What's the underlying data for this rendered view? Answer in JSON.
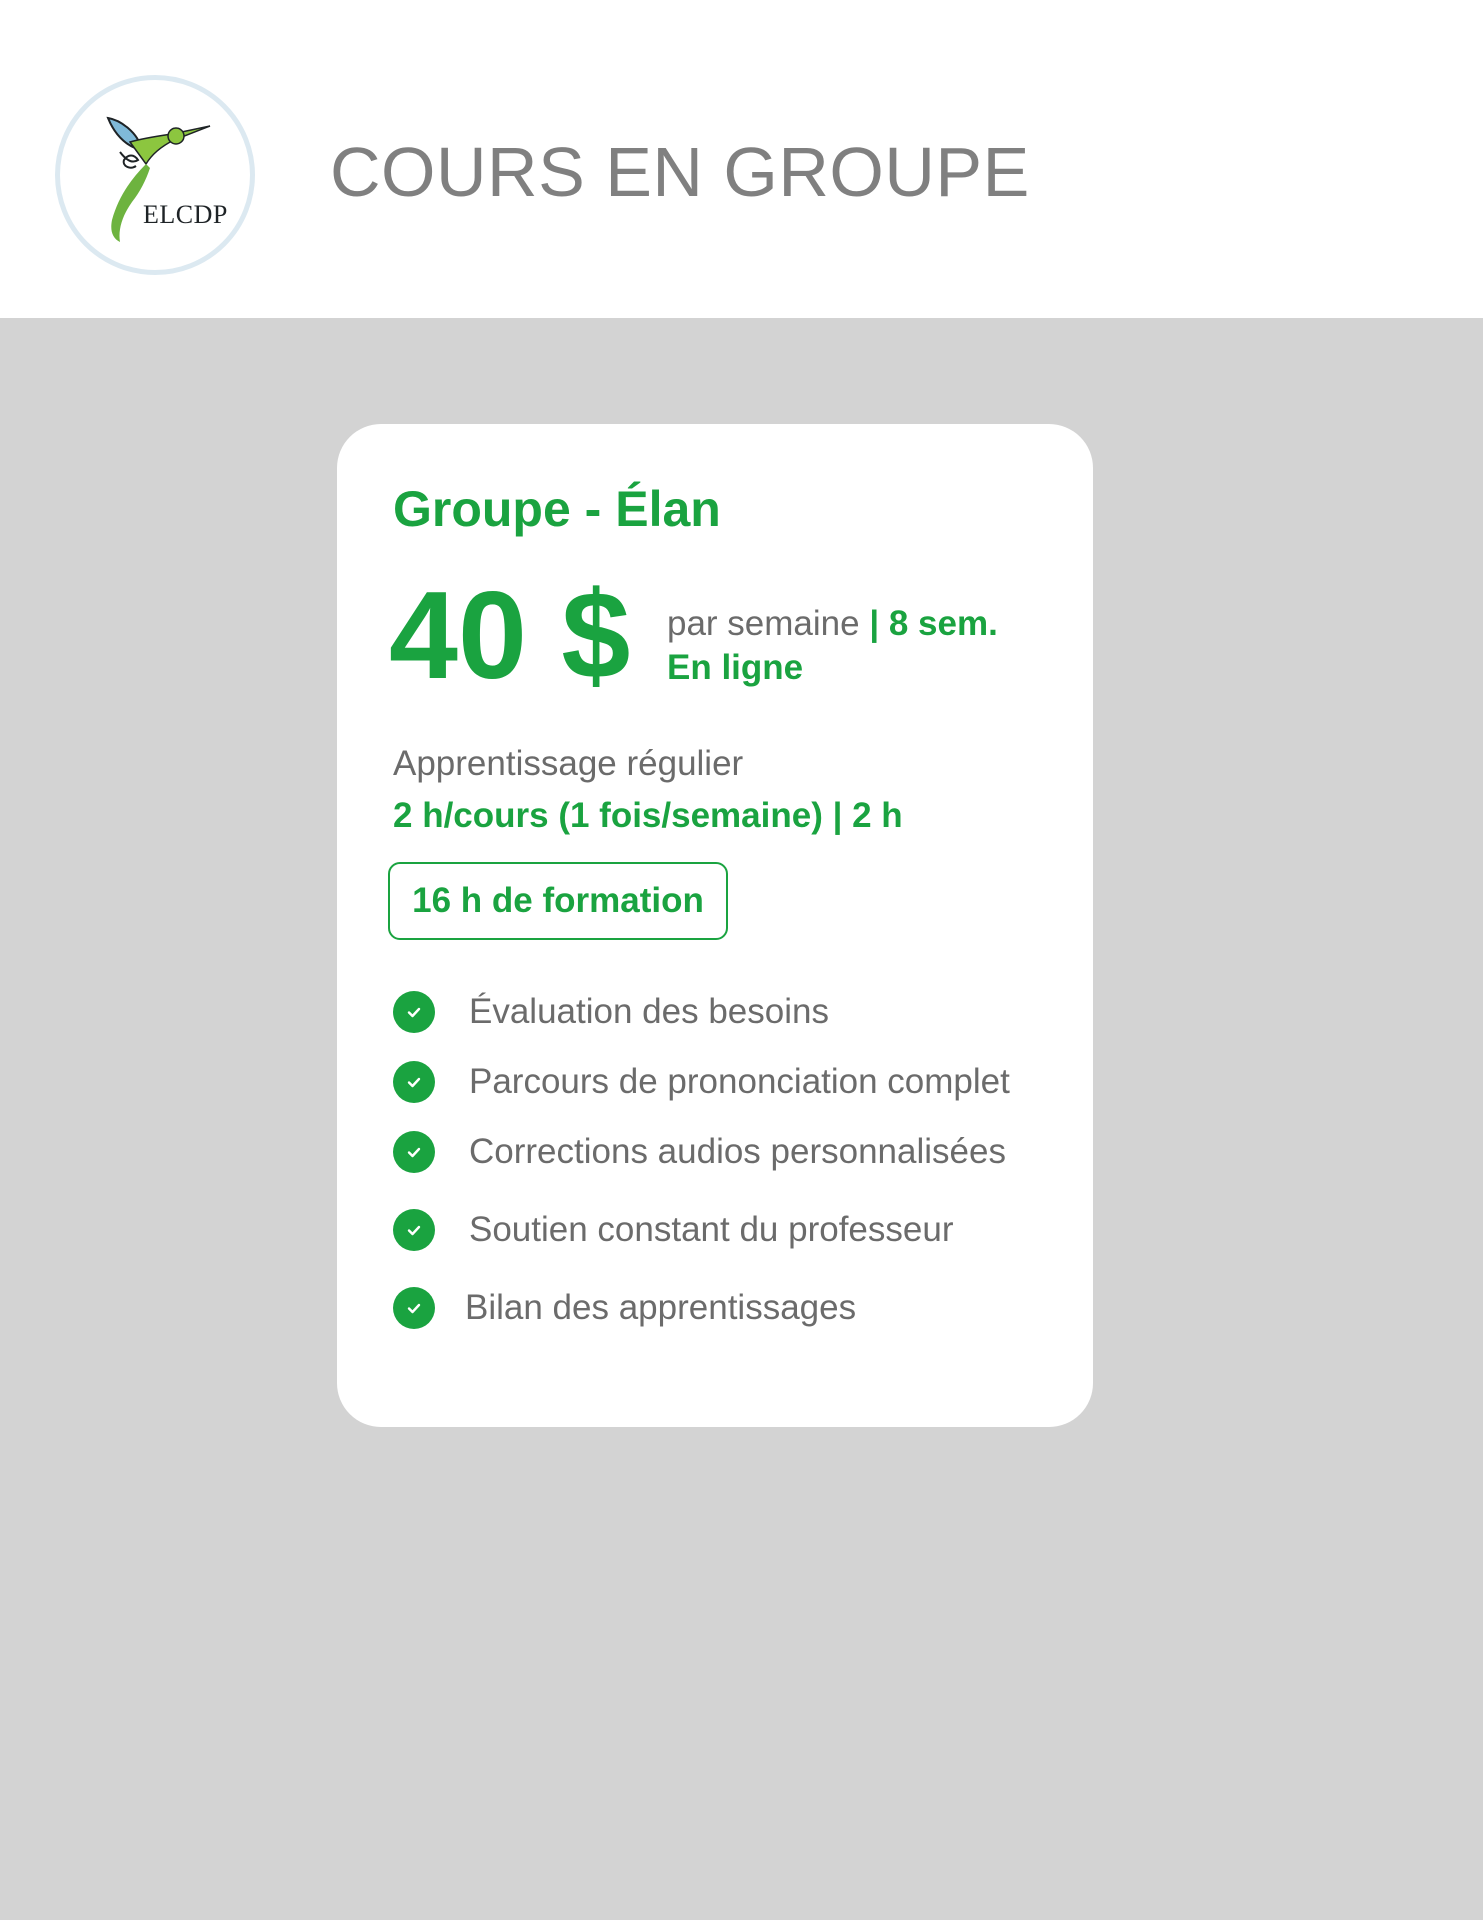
{
  "brand": {
    "logo_text": "ELCDP"
  },
  "header": {
    "title": "COURS EN GROUPE"
  },
  "card": {
    "title": "Groupe - Élan",
    "price": "40 $",
    "price_unit": "par semaine",
    "duration": " | 8 sem.",
    "mode": "En ligne",
    "subtitle": "Apprentissage régulier",
    "schedule": "2 h/cours (1 fois/semaine)  | 2 h",
    "badge": "16 h de formation",
    "features": [
      "Évaluation des besoins",
      "Parcours de prononciation complet",
      "Corrections audios personnalisées",
      "Soutien constant du professeur",
      "Bilan des apprentissages"
    ]
  },
  "colors": {
    "accent": "#1aa340",
    "text_grey": "#6b6b6b",
    "title_grey": "#808080",
    "background": "#d3d3d3"
  },
  "icons": {
    "feature": "check-circle-icon",
    "logo": "hummingbird-logo"
  }
}
